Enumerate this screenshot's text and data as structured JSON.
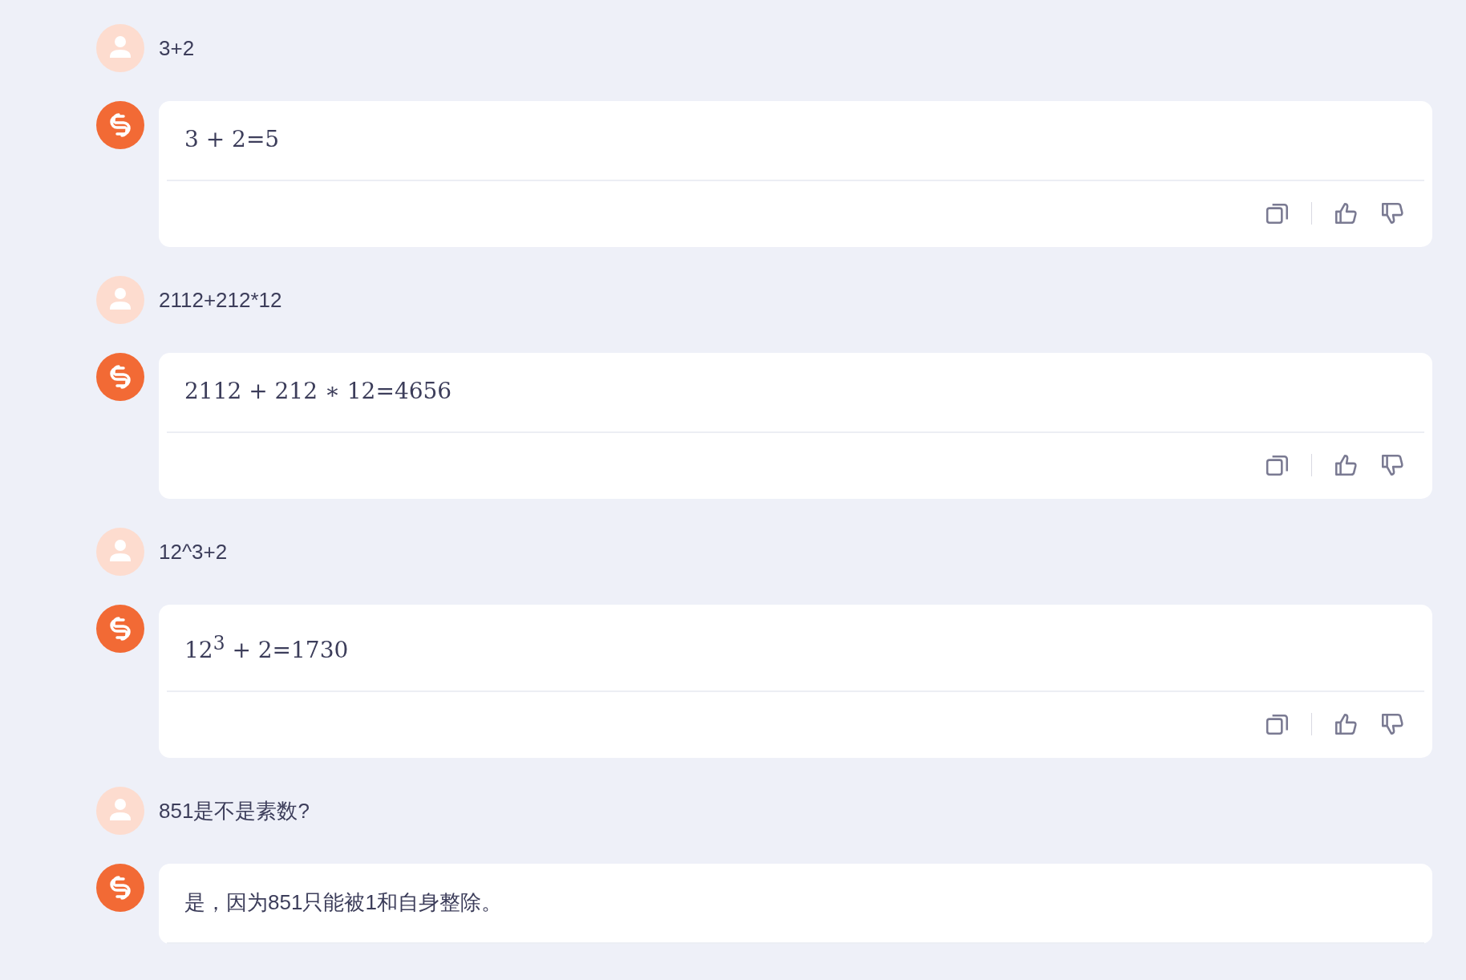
{
  "messages": [
    {
      "kind": "user",
      "text": "3+2"
    },
    {
      "kind": "bot",
      "text": "3 + 2=5",
      "math": true,
      "actions": [
        {
          "kind": "copy"
        },
        {
          "kind": "like"
        },
        {
          "kind": "dislike"
        }
      ]
    },
    {
      "kind": "user",
      "text": "2112+212*12"
    },
    {
      "kind": "bot",
      "text": "2112 + 212 ∗ 12=4656",
      "math": true,
      "actions": [
        {
          "kind": "copy"
        },
        {
          "kind": "like"
        },
        {
          "kind": "dislike"
        }
      ]
    },
    {
      "kind": "user",
      "text": "12^3+2"
    },
    {
      "kind": "bot",
      "text": "12$^{3}$ + 2=1730",
      "math": true,
      "actions": [
        {
          "kind": "copy"
        },
        {
          "kind": "like"
        },
        {
          "kind": "dislike"
        }
      ]
    },
    {
      "kind": "user",
      "text": "851是不是素数?"
    },
    {
      "kind": "bot",
      "text": "是，因为851只能被1和自身整除。",
      "math": false
    }
  ]
}
